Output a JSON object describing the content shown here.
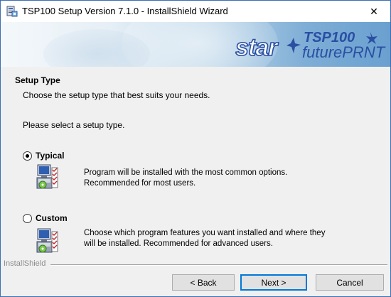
{
  "window": {
    "title": "TSP100 Setup Version 7.1.0 - InstallShield Wizard",
    "close_glyph": "✕"
  },
  "banner": {
    "brand": "star",
    "product_top": "TSP100",
    "product_bottom": "futurePRNT",
    "brand_color": "#2a4fa3"
  },
  "page": {
    "heading": "Setup Type",
    "subheading": "Choose the setup type that best suits your needs.",
    "prompt": "Please select a setup type."
  },
  "options": [
    {
      "label": "Typical",
      "selected": true,
      "icon": "install-package-icon",
      "desc_line1": "Program will be installed with the most common options.",
      "desc_line2": "Recommended for most users."
    },
    {
      "label": "Custom",
      "selected": false,
      "icon": "install-package-icon",
      "desc_line1": "Choose which program features you want installed and where they",
      "desc_line2": "will be installed. Recommended for advanced users."
    }
  ],
  "footer": {
    "brand": "InstallShield",
    "back_label": "< Back",
    "next_label": "Next >",
    "cancel_label": "Cancel"
  },
  "colors": {
    "accent": "#0078d7",
    "window_border": "#3c6fb4",
    "dialog_bg": "#f0f0f0"
  }
}
